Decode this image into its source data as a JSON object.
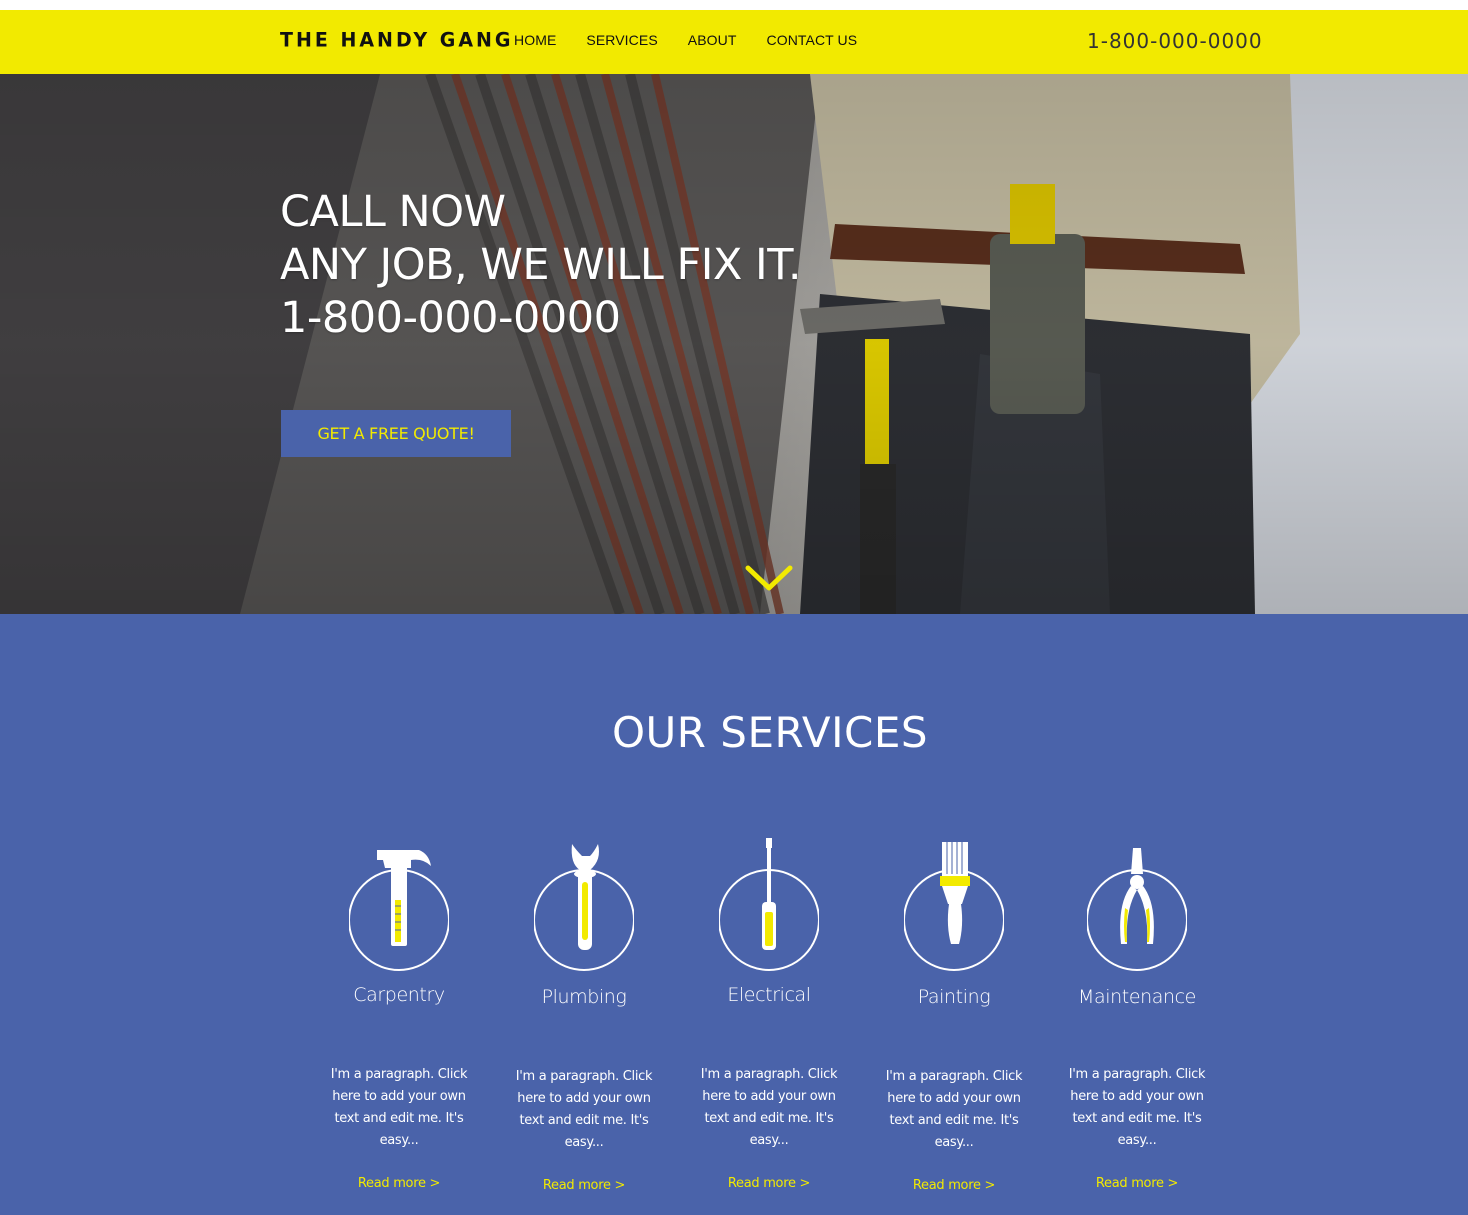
{
  "header": {
    "logo": "THE HANDY GANG",
    "nav": [
      {
        "label": "HOME"
      },
      {
        "label": "SERVICES"
      },
      {
        "label": "ABOUT"
      },
      {
        "label": "CONTACT US"
      }
    ],
    "phone": "1-800-000-0000"
  },
  "hero": {
    "line1": "CALL NOW",
    "line2": "ANY JOB, WE WILL FIX IT.",
    "line3": "1-800-000-0000",
    "cta_label": "GET A FREE QUOTE!",
    "scroll_icon": "chevron-down-icon"
  },
  "services": {
    "title": "OUR SERVICES",
    "items": [
      {
        "name": "Carpentry",
        "icon": "hammer-icon",
        "desc": "I'm a paragraph. Click here to add your own text and edit me. It's easy...",
        "link": "Read more >"
      },
      {
        "name": "Plumbing",
        "icon": "wrench-icon",
        "desc": "I'm a paragraph. Click here to add your own text and edit me. It's easy...",
        "link": "Read more >"
      },
      {
        "name": "Electrical",
        "icon": "screwdriver-icon",
        "desc": "I'm a paragraph. Click here to add your own text and edit me. It's easy...",
        "link": "Read more >"
      },
      {
        "name": "Painting",
        "icon": "paintbrush-icon",
        "desc": "I'm a paragraph. Click here to add your own text and edit me. It's easy...",
        "link": "Read more >"
      },
      {
        "name": "Maintenance",
        "icon": "pliers-icon",
        "desc": "I'm a paragraph. Click here to add your own text and edit me. It's easy...",
        "link": "Read more >"
      }
    ]
  },
  "colors": {
    "header_bg": "#f2ea00",
    "accent_blue": "#4a63aa",
    "accent_yellow": "#f2ea00",
    "text_dark": "#111111"
  }
}
